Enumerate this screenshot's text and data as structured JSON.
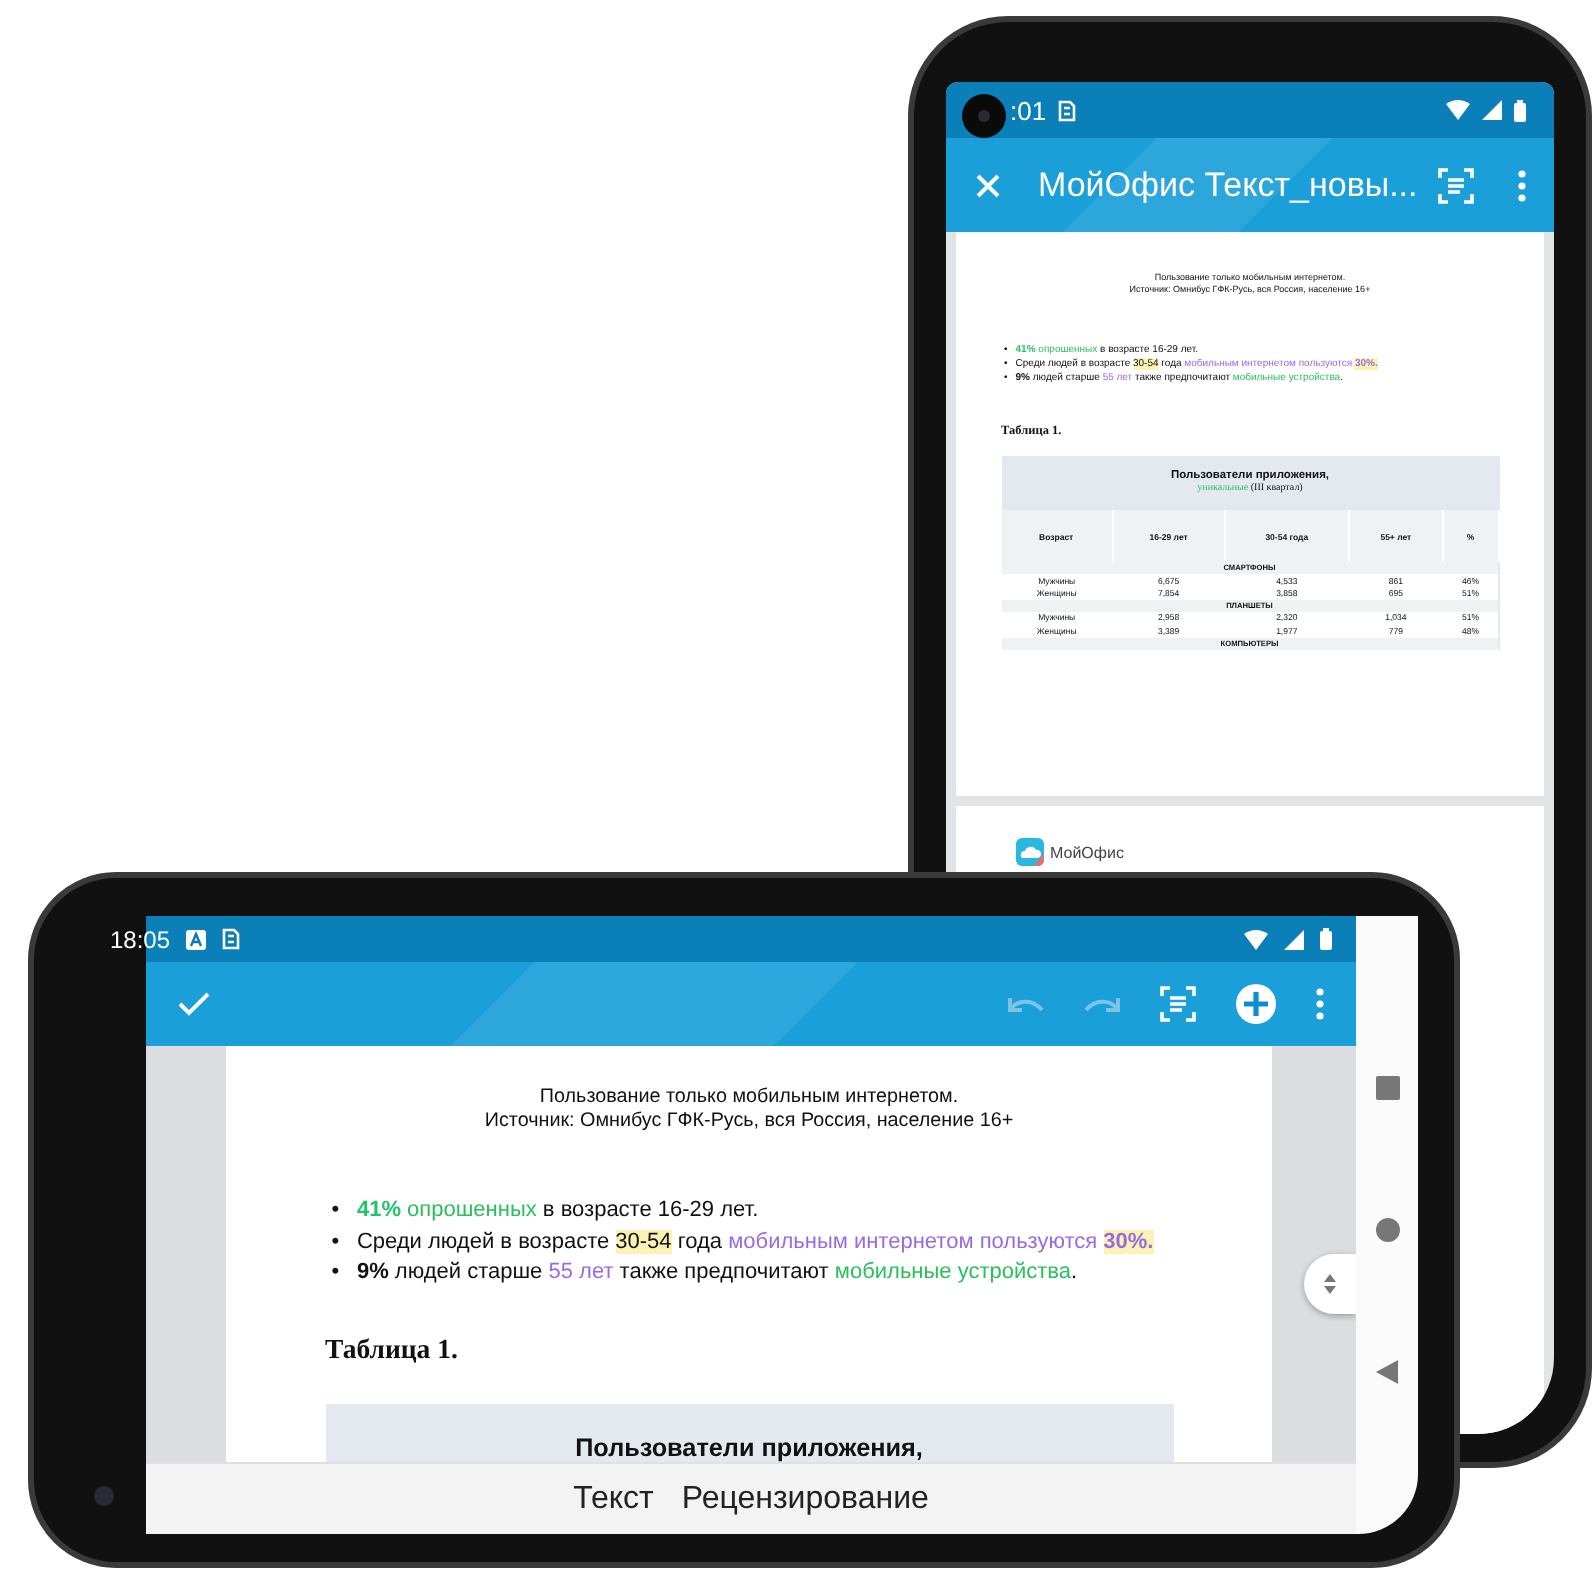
{
  "back_phone": {
    "status_bar": {
      "time": ":01"
    },
    "app_bar": {
      "title": "МойОфис Текст_новы..."
    },
    "document": {
      "caption": [
        "Пользование только мобильным интернетом.",
        "Источник: Омнибус ГФК-Русь, вся Россия, население 16+"
      ],
      "bullets": [
        {
          "marker": "•",
          "parts": [
            {
              "text": "41%",
              "kind": "green-bold"
            },
            {
              "text": " опрошенных",
              "kind": "green"
            },
            {
              "text": " в возрасте 16-29 лет.",
              "kind": "plain"
            }
          ]
        },
        {
          "marker": "•",
          "parts": [
            {
              "text": "Среди людей в возрасте ",
              "kind": "plain"
            },
            {
              "text": "30-54",
              "kind": "marked"
            },
            {
              "text": " года ",
              "kind": "plain"
            },
            {
              "text": "мобильным интернетом пользуются ",
              "kind": "purple"
            },
            {
              "text": "30%.",
              "kind": "purple-bold-marked"
            }
          ]
        },
        {
          "marker": "•",
          "parts": [
            {
              "text": "9%",
              "kind": "bold"
            },
            {
              "text": " людей старше ",
              "kind": "plain"
            },
            {
              "text": "55 лет",
              "kind": "purple"
            },
            {
              "text": " также предпочитают ",
              "kind": "plain"
            },
            {
              "text": "мобильные устройства",
              "kind": "green"
            },
            {
              "text": ".",
              "kind": "plain"
            }
          ]
        }
      ],
      "table_title": "Таблица 1.",
      "table": {
        "title": "Пользователи приложения,",
        "subtitle": [
          {
            "text": "уникальные",
            "kind": "green"
          },
          {
            "text": " (III квартал)",
            "kind": "plain"
          }
        ],
        "columns": [
          "Возраст",
          "16-29 лет",
          "30-54 года",
          "55+ лет",
          "%"
        ],
        "rows": [
          {
            "kind": "section",
            "label": "СМАРТФОНЫ"
          },
          {
            "kind": "data",
            "cells": [
              "Мужчины",
              "6,675",
              "4,533",
              "861",
              "46%"
            ]
          },
          {
            "kind": "data",
            "cells": [
              "Женщины",
              "7,854",
              "3,858",
              "695",
              "51%"
            ]
          },
          {
            "kind": "section",
            "label": "ПЛАНШЕТЫ"
          },
          {
            "kind": "data",
            "cells": [
              "Мужчины",
              "2,958",
              "2,320",
              "1,034",
              "51%"
            ]
          },
          {
            "kind": "data",
            "cells": [
              "Женщины",
              "3,389",
              "1,977",
              "779",
              "48%"
            ]
          },
          {
            "kind": "section",
            "label": "КОМПЬЮТЕРЫ"
          }
        ]
      },
      "next_page": {
        "logo_text": "МойОфис"
      }
    }
  },
  "front_phone": {
    "status_bar": {
      "time": "18:05"
    },
    "document": {
      "caption": [
        "Пользование только мобильным интернетом.",
        "Источник: Омнибус ГФК-Русь, вся Россия, население 16+"
      ],
      "bullets": [
        {
          "marker": "•",
          "parts": [
            {
              "text": "41%",
              "kind": "green-bold"
            },
            {
              "text": " опрошенных",
              "kind": "green"
            },
            {
              "text": " в возрасте 16-29 лет.",
              "kind": "plain"
            }
          ]
        },
        {
          "marker": "•",
          "parts": [
            {
              "text": "Среди людей в возрасте ",
              "kind": "plain"
            },
            {
              "text": "30-54",
              "kind": "marked"
            },
            {
              "text": " года ",
              "kind": "plain"
            },
            {
              "text": "мобильным интернетом пользуются ",
              "kind": "purple"
            },
            {
              "text": "30%.",
              "kind": "purple-bold-marked"
            }
          ]
        },
        {
          "marker": "•",
          "parts": [
            {
              "text": "9%",
              "kind": "bold"
            },
            {
              "text": " людей старше ",
              "kind": "plain"
            },
            {
              "text": "55 лет",
              "kind": "purple"
            },
            {
              "text": " также предпочитают ",
              "kind": "plain"
            },
            {
              "text": "мобильные устройства",
              "kind": "green"
            },
            {
              "text": ".",
              "kind": "plain"
            }
          ]
        }
      ],
      "table_title": "Таблица 1.",
      "table": {
        "title": "Пользователи приложения,"
      }
    },
    "bottom_tabs": [
      "Текст",
      "Рецензирование"
    ]
  }
}
